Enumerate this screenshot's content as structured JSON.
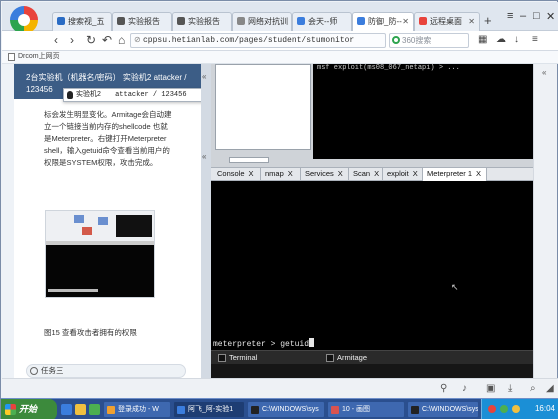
{
  "browser": {
    "tabs": [
      {
        "label": "搜索视_五",
        "icon_color": "#2b6cc4"
      },
      {
        "label": "实验报告",
        "icon_color": "#555555"
      },
      {
        "label": "实验报告",
        "icon_color": "#555555"
      },
      {
        "label": "网络对抗训",
        "icon_color": "#888888"
      },
      {
        "label": "会天--师",
        "icon_color": "#3b7ddd"
      },
      {
        "label": "防御_防--",
        "icon_color": "#3b7ddd"
      },
      {
        "label": "远程桌面",
        "icon_color": "#e8433c"
      }
    ],
    "new_tab": "+",
    "window_controls": {
      "menu": "≡",
      "minimize": "–",
      "maximize": "□",
      "close": "✕"
    },
    "nav": {
      "back": "‹",
      "forward": "›",
      "reload": "↻",
      "undo": "↶",
      "home": "⌂"
    },
    "url": "cppsu.hetianlab.com/pages/student/stumonitor",
    "search_placeholder": "360搜索",
    "toolbar_icons": [
      "grid-icon",
      "cloud-icon",
      "download-icon",
      "menu-icon"
    ],
    "bookmark": "Drcom上网页"
  },
  "left_panel": {
    "header_line1": "2台实验机（机器名/密码）     实验机2    attacker / 123456",
    "body": "标会发生明显变化。Armitage会自动建立一个链接当前内存的shellcode 也就是Meterpreter。右键打开Meterpreter shell，输入getuid命令查看当前用户的权限是SYSTEM权限，攻击完成。",
    "caption": "图15 查看攻击者拥有的权限",
    "task_label": "任务三"
  },
  "vm_select": {
    "name": "实验机2",
    "value": "attacker / 123456"
  },
  "vm": {
    "pane3_text": "msf exploit(ms08_067_netapi) > ...",
    "tabs": [
      {
        "label": "Console",
        "close": "X"
      },
      {
        "label": "nmap",
        "close": "X"
      },
      {
        "label": "Services",
        "close": "X"
      },
      {
        "label": "Scan",
        "close": "X"
      },
      {
        "label": "exploit",
        "close": "X"
      },
      {
        "label": "Meterpreter 1",
        "close": "X"
      }
    ],
    "prompt": "meterpreter > getuid",
    "bottom_tabs": [
      "Terminal",
      "Armitage"
    ]
  },
  "taskbar": {
    "start": "开始",
    "tasks": [
      {
        "label": "登录成功 - W",
        "icon_color": "#f0a030"
      },
      {
        "label": "阿飞_阿-实验1",
        "icon_color": "#3b7ddd"
      },
      {
        "label": "C:\\WINDOWS\\sys",
        "icon_color": "#222222"
      },
      {
        "label": "10 - 画图",
        "icon_color": "#d9534f"
      },
      {
        "label": "C:\\WINDOWS\\sys",
        "icon_color": "#222222"
      }
    ],
    "clock": "16:04"
  }
}
